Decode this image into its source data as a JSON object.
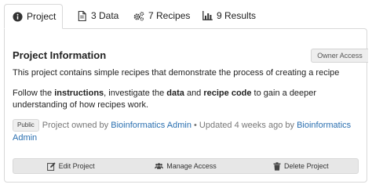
{
  "tabs": [
    {
      "label": "Project",
      "icon": "info-circle-icon"
    },
    {
      "label": "3 Data",
      "icon": "file-icon"
    },
    {
      "label": "7 Recipes",
      "icon": "gears-icon"
    },
    {
      "label": "9 Results",
      "icon": "bar-chart-icon"
    }
  ],
  "owner_access": "Owner Access",
  "title": "Project Information",
  "description": "This project contains simple recipes that demonstrate the process of creating a recipe",
  "follow": {
    "p1": "Follow the ",
    "b1": "instructions",
    "p2": ", investigate the ",
    "b2": "data",
    "p3": " and ",
    "b3": "recipe code",
    "p4": " to gain a deeper understanding of how recipes work."
  },
  "meta": {
    "badge": "Public",
    "owned_by": "Project owned by ",
    "owner": "Bioinformatics Admin",
    "sep": " • ",
    "updated": "Updated 4 weeks ago by ",
    "updater": "Bioinformatics Admin"
  },
  "actions": {
    "edit": "Edit Project",
    "manage": "Manage Access",
    "delete": "Delete Project"
  },
  "colors": {
    "link": "#2a6fb0",
    "badge_bg": "#eeeeee",
    "footer_bg": "#e7e7e7"
  }
}
